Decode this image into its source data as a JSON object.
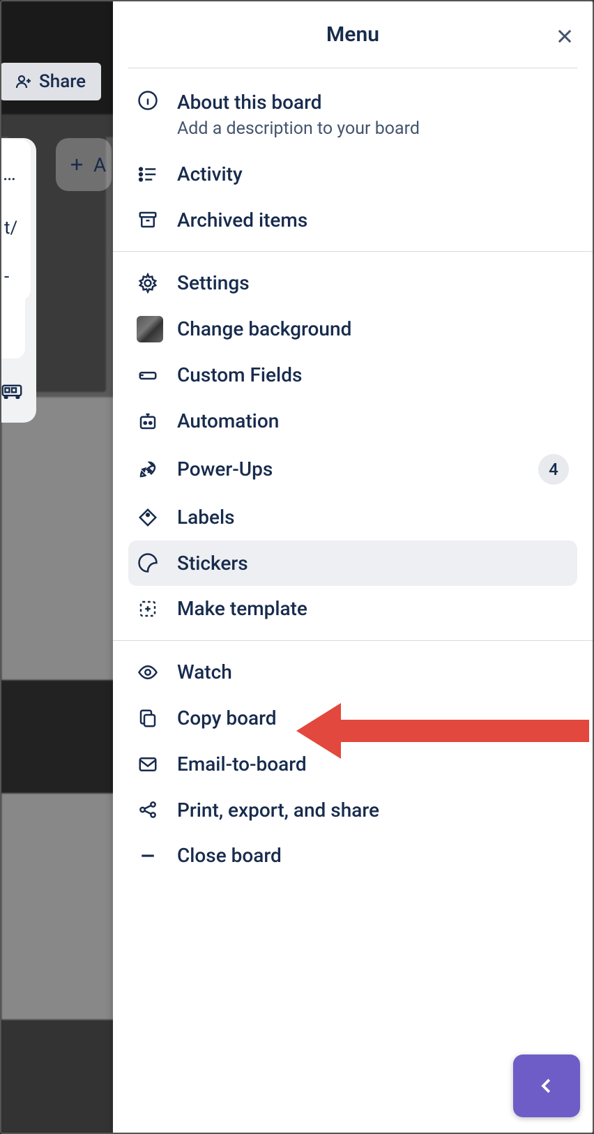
{
  "header": {
    "share_label": "Share",
    "add_list_label": "A"
  },
  "card_stub": {
    "text1": "t/",
    "text2": "-"
  },
  "menu": {
    "title": "Menu",
    "sections": [
      {
        "items": [
          {
            "label": "About this board",
            "sub": "Add a description to your board"
          },
          {
            "label": "Activity"
          },
          {
            "label": "Archived items"
          }
        ]
      },
      {
        "items": [
          {
            "label": "Settings"
          },
          {
            "label": "Change background"
          },
          {
            "label": "Custom Fields"
          },
          {
            "label": "Automation"
          },
          {
            "label": "Power-Ups",
            "badge": "4"
          },
          {
            "label": "Labels"
          },
          {
            "label": "Stickers",
            "hover": true
          },
          {
            "label": "Make template"
          }
        ]
      },
      {
        "items": [
          {
            "label": "Watch"
          },
          {
            "label": "Copy board"
          },
          {
            "label": "Email-to-board"
          },
          {
            "label": "Print, export, and share"
          },
          {
            "label": "Close board"
          }
        ]
      }
    ]
  }
}
